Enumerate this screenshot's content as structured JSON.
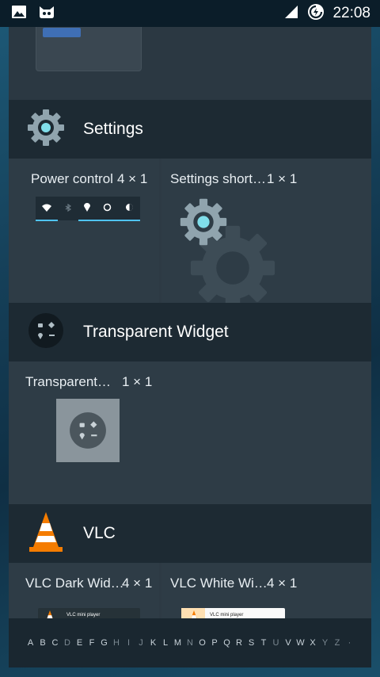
{
  "status_bar": {
    "time": "22:08",
    "icons": [
      "image-icon",
      "cat-face-icon",
      "signal-icon",
      "data-sync-icon"
    ]
  },
  "sections": {
    "settings": {
      "app_name": "Settings",
      "widgets": [
        {
          "label": "Power control",
          "size": "4 × 1"
        },
        {
          "label": "Settings short…",
          "size": "1 × 1"
        }
      ]
    },
    "transparent": {
      "app_name": "Transparent Widget",
      "widgets": [
        {
          "label": "Transparent…",
          "size": "1 × 1"
        }
      ]
    },
    "vlc": {
      "app_name": "VLC",
      "widgets": [
        {
          "label": "VLC Dark Wid…",
          "size": "4 × 1",
          "player_text": "VLC mini player"
        },
        {
          "label": "VLC White Wi…",
          "size": "4 × 1",
          "player_text": "VLC mini player"
        }
      ]
    }
  },
  "alphabet": [
    "A",
    "B",
    "C",
    "D",
    "E",
    "F",
    "G",
    "H",
    "I",
    "J",
    "K",
    "L",
    "M",
    "N",
    "O",
    "P",
    "Q",
    "R",
    "S",
    "T",
    "U",
    "V",
    "W",
    "X",
    "Y",
    "Z",
    "·"
  ],
  "alphabet_dim": [
    "D",
    "H",
    "I",
    "J",
    "N",
    "U",
    "Y",
    "Z",
    "·"
  ],
  "colors": {
    "accent": "#4fc3f7",
    "header_bg": "#1d2a33",
    "panel_bg": "#2d3a44",
    "vlc_orange": "#f57c00"
  }
}
